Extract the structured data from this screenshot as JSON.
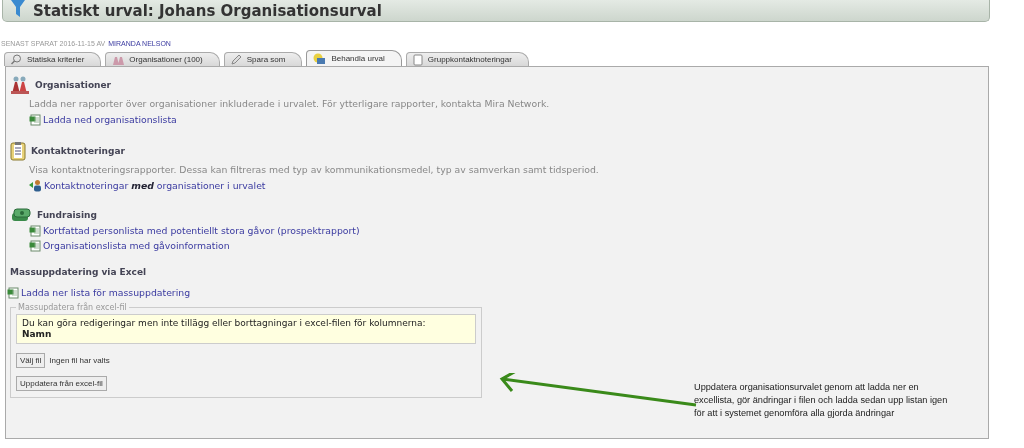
{
  "header": {
    "title": "Statiskt urval: Johans Organisationsurval"
  },
  "saved": {
    "label": "SENAST SPARAT 2016-11-15 AV",
    "user": "MIRANDA NELSON"
  },
  "tabs": [
    {
      "label": "Statiska kriterier",
      "selected": false
    },
    {
      "label": "Organisationer (100)",
      "selected": false
    },
    {
      "label": "Spara som",
      "selected": false
    },
    {
      "label": "Behandla urval",
      "selected": true
    },
    {
      "label": "Gruppkontaktnoteringar",
      "selected": false
    }
  ],
  "sections": [
    {
      "title": "Organisationer",
      "description": "Ladda ner rapporter över organisationer inkluderade i urvalet. För ytterligare rapporter, kontakta Mira Network.",
      "links": [
        "Ladda ned organisationslista"
      ]
    },
    {
      "title": "Kontaktnoteringar",
      "description": "Visa kontaktnoteringsrapporter. Dessa kan filtreras med typ av kommunikationsmedel, typ av samverkan samt tidsperiod.",
      "links": [
        "Kontaktnoteringar **med** organisationer i urvalet"
      ]
    },
    {
      "title": "Fundraising",
      "links": [
        "Kortfattad personlista med potentiellt stora gåvor (prospektrapport)",
        "Organisationslista med gåvoinformation"
      ]
    }
  ],
  "mass_update": {
    "title": "Massuppdatering via Excel",
    "link": "Ladda ner lista för massuppdatering",
    "legend": "Massupdatera från excel-fil",
    "notice": "Du kan göra redigeringar men inte tillägg eller borttagningar i excel-filen för kolumnerna:",
    "notice_column": "Namn",
    "choose_button": "Välj fil",
    "no_file": "Ingen fil har valts",
    "submit_button": "Uppdatera från excel-fil"
  },
  "annotation": {
    "text": "Uppdatera organisationsurvalet genom att ladda ner en excellista, gör ändringar i filen och ladda sedan upp listan igen för att i systemet genomföra alla gjorda ändringar"
  }
}
